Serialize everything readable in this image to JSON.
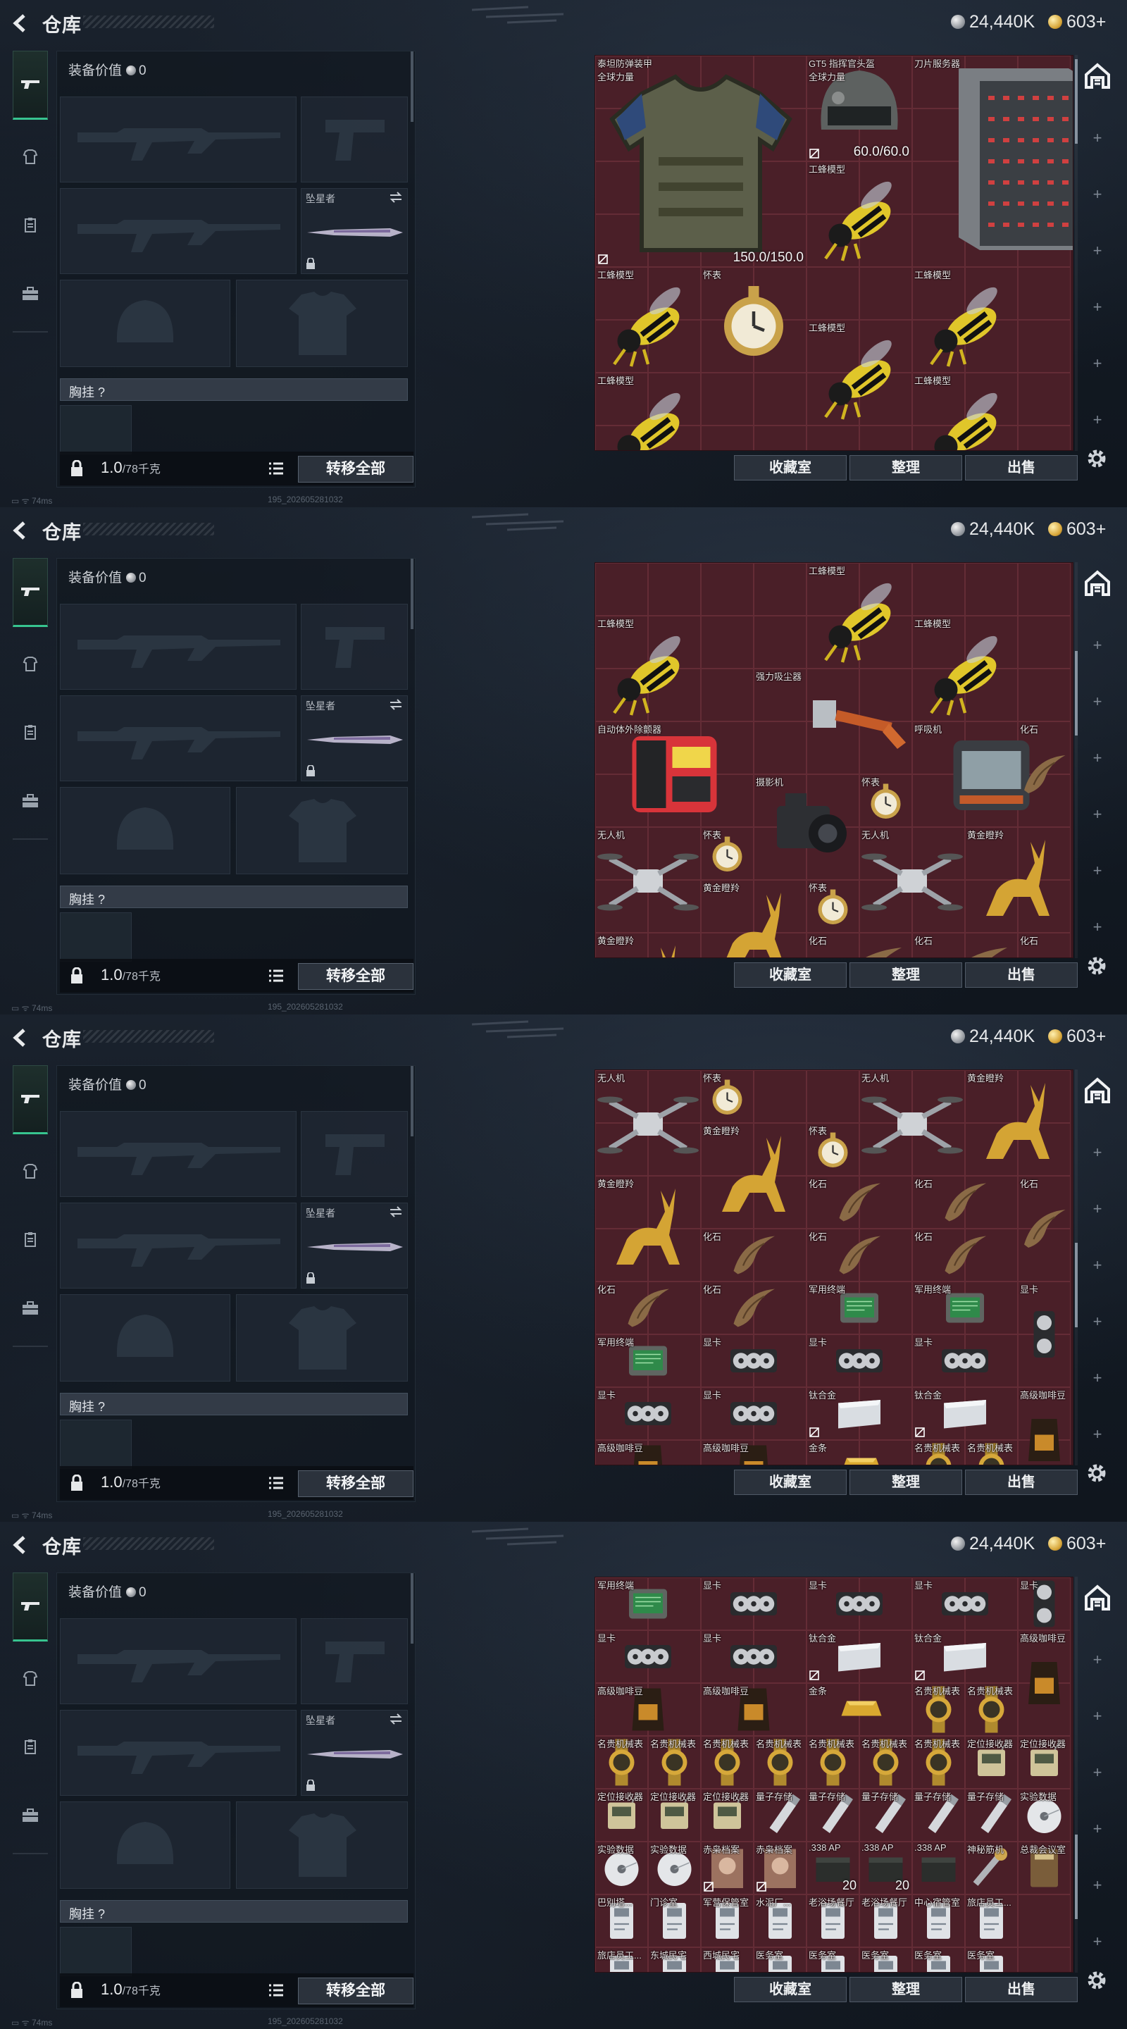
{
  "header": {
    "title": "仓库",
    "currency_1": "24,440K",
    "currency_2": "603+"
  },
  "loadout": {
    "equip_value_label": "装备价值",
    "equip_value": "0",
    "melee_label": "坠星者",
    "chest_label": "胸挂 ?",
    "weight_current": "1.0",
    "weight_max": "/78千克",
    "transfer_all": "转移全部"
  },
  "storage": {
    "buttons": {
      "collection": "收藏室",
      "organize": "整理",
      "sell": "出售"
    }
  },
  "status": {
    "ping": "74ms",
    "build": "195_202605281032"
  },
  "frames": [
    {
      "items": [
        {
          "label": "泰坦防弹装甲\n全球力量",
          "art": "armor",
          "col": 0,
          "row": 0,
          "w": 2,
          "h": 2,
          "durability": "150.0/150.0",
          "nodrop": true
        },
        {
          "label": "GT5 指挥官头盔\n全球力量",
          "art": "helmet",
          "col": 2,
          "row": 0,
          "w": 1,
          "h": 1,
          "durability": "60.0/60.0",
          "nodrop": true
        },
        {
          "label": "刀片服务器",
          "art": "server",
          "col": 3,
          "row": 0,
          "w": 2,
          "h": 2
        },
        {
          "label": "工蜂模型",
          "art": "bee",
          "col": 2,
          "row": 1,
          "w": 1,
          "h": 1
        },
        {
          "label": "工蜂模型",
          "art": "bee",
          "col": 0,
          "row": 2,
          "w": 1,
          "h": 1
        },
        {
          "label": "怀表",
          "art": "watch",
          "col": 1,
          "row": 2,
          "w": 1,
          "h": 1
        },
        {
          "label": "工蜂模型",
          "art": "bee",
          "col": 3,
          "row": 2,
          "w": 1,
          "h": 1
        },
        {
          "label": "工蜂模型",
          "art": "bee",
          "col": 2,
          "row": 2.5,
          "w": 1,
          "h": 1
        },
        {
          "label": "工蜂模型",
          "art": "bee",
          "col": 0,
          "row": 3,
          "w": 1,
          "h": 1
        },
        {
          "label": "工蜂模型",
          "art": "bee",
          "col": 3,
          "row": 3,
          "w": 1,
          "h": 1
        }
      ],
      "scroll": 0
    },
    {
      "items": [
        {
          "label": "工蜂模型",
          "art": "bee",
          "col": 2,
          "row": 0,
          "w": 1,
          "h": 1
        },
        {
          "label": "工蜂模型",
          "art": "bee",
          "col": 0,
          "row": 0.5,
          "w": 1,
          "h": 1
        },
        {
          "label": "工蜂模型",
          "art": "bee",
          "col": 3,
          "row": 0.5,
          "w": 1,
          "h": 1
        },
        {
          "label": "强力吸尘器",
          "art": "vacuum",
          "col": 1.5,
          "row": 1,
          "w": 2,
          "h": 1
        },
        {
          "label": "自动体外除颤器",
          "art": "aed",
          "col": 0,
          "row": 1.5,
          "w": 1.5,
          "h": 1
        },
        {
          "label": "呼吸机",
          "art": "ventilator",
          "col": 3,
          "row": 1.5,
          "w": 1.5,
          "h": 1
        },
        {
          "label": "化石",
          "art": "fossil",
          "col": 4,
          "row": 1.5,
          "w": 0.5,
          "h": 1
        },
        {
          "label": "摄影机",
          "art": "camera",
          "col": 1.5,
          "row": 2,
          "w": 1,
          "h": 1
        },
        {
          "label": "怀表",
          "art": "watch",
          "col": 2.5,
          "row": 2,
          "w": 0.5,
          "h": 0.5
        },
        {
          "label": "无人机",
          "art": "drone",
          "col": 0,
          "row": 2.5,
          "w": 1,
          "h": 1
        },
        {
          "label": "怀表",
          "art": "watch",
          "col": 1,
          "row": 2.5,
          "w": 0.5,
          "h": 0.5
        },
        {
          "label": "无人机",
          "art": "drone",
          "col": 2.5,
          "row": 2.5,
          "w": 1,
          "h": 1
        },
        {
          "label": "黄金瞪羚",
          "art": "gazelle",
          "col": 3.5,
          "row": 2.5,
          "w": 1,
          "h": 1
        },
        {
          "label": "黄金瞪羚",
          "art": "gazelle",
          "col": 1,
          "row": 3,
          "w": 1,
          "h": 1
        },
        {
          "label": "怀表",
          "art": "watch",
          "col": 2,
          "row": 3,
          "w": 0.5,
          "h": 0.5
        },
        {
          "label": "黄金瞪羚",
          "art": "gazelle",
          "col": 0,
          "row": 3.5,
          "w": 1,
          "h": 1
        },
        {
          "label": "化石",
          "art": "fossil",
          "col": 2,
          "row": 3.5,
          "w": 1,
          "h": 1
        },
        {
          "label": "化石",
          "art": "fossil",
          "col": 3,
          "row": 3.5,
          "w": 1,
          "h": 1
        },
        {
          "label": "化石",
          "art": "fossil",
          "col": 4,
          "row": 3.5,
          "w": 1,
          "h": 1
        }
      ],
      "scroll": 1
    },
    {
      "items": [
        {
          "label": "无人机",
          "art": "drone",
          "col": 0,
          "row": 0,
          "w": 1,
          "h": 1
        },
        {
          "label": "怀表",
          "art": "watch",
          "col": 1,
          "row": 0,
          "w": 0.5,
          "h": 0.5
        },
        {
          "label": "无人机",
          "art": "drone",
          "col": 2.5,
          "row": 0,
          "w": 1,
          "h": 1
        },
        {
          "label": "黄金瞪羚",
          "art": "gazelle",
          "col": 3.5,
          "row": 0,
          "w": 1,
          "h": 1
        },
        {
          "label": "黄金瞪羚",
          "art": "gazelle",
          "col": 1,
          "row": 0.5,
          "w": 1,
          "h": 1
        },
        {
          "label": "怀表",
          "art": "watch",
          "col": 2,
          "row": 0.5,
          "w": 0.5,
          "h": 0.5
        },
        {
          "label": "黄金瞪羚",
          "art": "gazelle",
          "col": 0,
          "row": 1,
          "w": 1,
          "h": 1
        },
        {
          "label": "化石",
          "art": "fossil",
          "col": 2,
          "row": 1,
          "w": 1,
          "h": 0.5
        },
        {
          "label": "化石",
          "art": "fossil",
          "col": 3,
          "row": 1,
          "w": 1,
          "h": 0.5
        },
        {
          "label": "化石",
          "art": "fossil",
          "col": 4,
          "row": 1,
          "w": 0.5,
          "h": 1
        },
        {
          "label": "化石",
          "art": "fossil",
          "col": 1,
          "row": 1.5,
          "w": 1,
          "h": 0.5
        },
        {
          "label": "化石",
          "art": "fossil",
          "col": 2,
          "row": 1.5,
          "w": 1,
          "h": 0.5
        },
        {
          "label": "化石",
          "art": "fossil",
          "col": 3,
          "row": 1.5,
          "w": 1,
          "h": 0.5
        },
        {
          "label": "化石",
          "art": "fossil",
          "col": 0,
          "row": 2,
          "w": 1,
          "h": 0.5
        },
        {
          "label": "化石",
          "art": "fossil",
          "col": 1,
          "row": 2,
          "w": 1,
          "h": 0.5
        },
        {
          "label": "军用终端",
          "art": "terminal",
          "col": 2,
          "row": 2,
          "w": 1,
          "h": 0.5
        },
        {
          "label": "军用终端",
          "art": "terminal",
          "col": 3,
          "row": 2,
          "w": 1,
          "h": 0.5
        },
        {
          "label": "显卡",
          "art": "gpu-v",
          "col": 4,
          "row": 2,
          "w": 0.5,
          "h": 1
        },
        {
          "label": "军用终端",
          "art": "terminal",
          "col": 0,
          "row": 2.5,
          "w": 1,
          "h": 0.5
        },
        {
          "label": "显卡",
          "art": "gpu",
          "col": 1,
          "row": 2.5,
          "w": 1,
          "h": 0.5
        },
        {
          "label": "显卡",
          "art": "gpu",
          "col": 2,
          "row": 2.5,
          "w": 1,
          "h": 0.5
        },
        {
          "label": "显卡",
          "art": "gpu",
          "col": 3,
          "row": 2.5,
          "w": 1,
          "h": 0.5
        },
        {
          "label": "显卡",
          "art": "gpu",
          "col": 0,
          "row": 3,
          "w": 1,
          "h": 0.5
        },
        {
          "label": "显卡",
          "art": "gpu",
          "col": 1,
          "row": 3,
          "w": 1,
          "h": 0.5
        },
        {
          "label": "钛合金",
          "art": "titanium",
          "col": 2,
          "row": 3,
          "w": 1,
          "h": 0.5,
          "nodrop": true
        },
        {
          "label": "钛合金",
          "art": "titanium",
          "col": 3,
          "row": 3,
          "w": 1,
          "h": 0.5,
          "nodrop": true
        },
        {
          "label": "高级咖啡豆",
          "art": "coffee",
          "col": 4,
          "row": 3,
          "w": 0.5,
          "h": 1
        },
        {
          "label": "高级咖啡豆",
          "art": "coffee",
          "col": 0,
          "row": 3.5,
          "w": 1,
          "h": 0.5
        },
        {
          "label": "高级咖啡豆",
          "art": "coffee",
          "col": 1,
          "row": 3.5,
          "w": 1,
          "h": 0.5
        },
        {
          "label": "金条",
          "art": "goldbar",
          "col": 2,
          "row": 3.5,
          "w": 1,
          "h": 0.5
        },
        {
          "label": "名贵机械表",
          "art": "mwatch",
          "col": 3,
          "row": 3.5,
          "w": 0.5,
          "h": 0.5
        },
        {
          "label": "名贵机械表",
          "art": "mwatch",
          "col": 3.5,
          "row": 3.5,
          "w": 0.5,
          "h": 0.5
        }
      ],
      "scroll": 2
    },
    {
      "items": [
        {
          "label": "军用终端",
          "art": "terminal",
          "col": 0,
          "row": 0,
          "w": 1,
          "h": 0.5
        },
        {
          "label": "显卡",
          "art": "gpu",
          "col": 1,
          "row": 0,
          "w": 1,
          "h": 0.5
        },
        {
          "label": "显卡",
          "art": "gpu",
          "col": 2,
          "row": 0,
          "w": 1,
          "h": 0.5
        },
        {
          "label": "显卡",
          "art": "gpu",
          "col": 3,
          "row": 0,
          "w": 1,
          "h": 0.5
        },
        {
          "label": "显卡",
          "art": "gpu-v",
          "col": 4,
          "row": 0,
          "w": 0.5,
          "h": 0.5
        },
        {
          "label": "显卡",
          "art": "gpu",
          "col": 0,
          "row": 0.5,
          "w": 1,
          "h": 0.5
        },
        {
          "label": "显卡",
          "art": "gpu",
          "col": 1,
          "row": 0.5,
          "w": 1,
          "h": 0.5
        },
        {
          "label": "钛合金",
          "art": "titanium",
          "col": 2,
          "row": 0.5,
          "w": 1,
          "h": 0.5,
          "nodrop": true
        },
        {
          "label": "钛合金",
          "art": "titanium",
          "col": 3,
          "row": 0.5,
          "w": 1,
          "h": 0.5,
          "nodrop": true
        },
        {
          "label": "高级咖啡豆",
          "art": "coffee",
          "col": 4,
          "row": 0.5,
          "w": 0.5,
          "h": 1
        },
        {
          "label": "高级咖啡豆",
          "art": "coffee",
          "col": 0,
          "row": 1,
          "w": 1,
          "h": 0.5
        },
        {
          "label": "高级咖啡豆",
          "art": "coffee",
          "col": 1,
          "row": 1,
          "w": 1,
          "h": 0.5
        },
        {
          "label": "金条",
          "art": "goldbar",
          "col": 2,
          "row": 1,
          "w": 1,
          "h": 0.5
        },
        {
          "label": "名贵机械表",
          "art": "mwatch",
          "col": 3,
          "row": 1,
          "w": 0.5,
          "h": 0.5
        },
        {
          "label": "名贵机械表",
          "art": "mwatch",
          "col": 3.5,
          "row": 1,
          "w": 0.5,
          "h": 0.5
        },
        {
          "label": "名贵机械表",
          "art": "mwatch",
          "col": 0,
          "row": 1.5,
          "w": 0.5,
          "h": 0.5
        },
        {
          "label": "名贵机械表",
          "art": "mwatch",
          "col": 0.5,
          "row": 1.5,
          "w": 0.5,
          "h": 0.5
        },
        {
          "label": "名贵机械表",
          "art": "mwatch",
          "col": 1,
          "row": 1.5,
          "w": 0.5,
          "h": 0.5
        },
        {
          "label": "名贵机械表",
          "art": "mwatch",
          "col": 1.5,
          "row": 1.5,
          "w": 0.5,
          "h": 0.5
        },
        {
          "label": "名贵机械表",
          "art": "mwatch",
          "col": 2,
          "row": 1.5,
          "w": 0.5,
          "h": 0.5
        },
        {
          "label": "名贵机械表",
          "art": "mwatch",
          "col": 2.5,
          "row": 1.5,
          "w": 0.5,
          "h": 0.5
        },
        {
          "label": "名贵机械表",
          "art": "mwatch",
          "col": 3,
          "row": 1.5,
          "w": 0.5,
          "h": 0.5
        },
        {
          "label": "定位接收器",
          "art": "receiver",
          "col": 3.5,
          "row": 1.5,
          "w": 0.5,
          "h": 0.5
        },
        {
          "label": "定位接收器",
          "art": "receiver",
          "col": 4,
          "row": 1.5,
          "w": 0.5,
          "h": 0.5
        },
        {
          "label": "定位接收器",
          "art": "receiver",
          "col": 0,
          "row": 2,
          "w": 0.5,
          "h": 0.5
        },
        {
          "label": "定位接收器",
          "art": "receiver",
          "col": 0.5,
          "row": 2,
          "w": 0.5,
          "h": 0.5
        },
        {
          "label": "定位接收器",
          "art": "receiver",
          "col": 1,
          "row": 2,
          "w": 0.5,
          "h": 0.5
        },
        {
          "label": "量子存储",
          "art": "usb",
          "col": 1.5,
          "row": 2,
          "w": 0.5,
          "h": 0.5
        },
        {
          "label": "量子存储",
          "art": "usb",
          "col": 2,
          "row": 2,
          "w": 0.5,
          "h": 0.5
        },
        {
          "label": "量子存储",
          "art": "usb",
          "col": 2.5,
          "row": 2,
          "w": 0.5,
          "h": 0.5
        },
        {
          "label": "量子存储",
          "art": "usb",
          "col": 3,
          "row": 2,
          "w": 0.5,
          "h": 0.5
        },
        {
          "label": "量子存储",
          "art": "usb",
          "col": 3.5,
          "row": 2,
          "w": 0.5,
          "h": 0.5
        },
        {
          "label": "实验数据",
          "art": "disc",
          "col": 4,
          "row": 2,
          "w": 0.5,
          "h": 0.5
        },
        {
          "label": "实验数据",
          "art": "disc",
          "col": 0,
          "row": 2.5,
          "w": 0.5,
          "h": 0.5
        },
        {
          "label": "实验数据",
          "art": "disc",
          "col": 0.5,
          "row": 2.5,
          "w": 0.5,
          "h": 0.5
        },
        {
          "label": "赤枭档案",
          "art": "file",
          "col": 1,
          "row": 2.5,
          "w": 0.5,
          "h": 0.5,
          "nodrop": true
        },
        {
          "label": "赤枭档案",
          "art": "file",
          "col": 1.5,
          "row": 2.5,
          "w": 0.5,
          "h": 0.5,
          "nodrop": true
        },
        {
          "label": ".338 AP",
          "art": "ammo",
          "col": 2,
          "row": 2.5,
          "w": 0.5,
          "h": 0.5,
          "count": "20"
        },
        {
          "label": ".338 AP",
          "art": "ammo",
          "col": 2.5,
          "row": 2.5,
          "w": 0.5,
          "h": 0.5,
          "count": "20"
        },
        {
          "label": ".338 AP",
          "art": "ammo",
          "col": 3,
          "row": 2.5,
          "w": 0.5,
          "h": 0.5
        },
        {
          "label": "神秘筋机",
          "art": "pipe",
          "col": 3.5,
          "row": 2.5,
          "w": 0.5,
          "h": 0.5
        },
        {
          "label": "总裁会议室",
          "art": "keycard",
          "col": 4,
          "row": 2.5,
          "w": 0.5,
          "h": 0.5
        },
        {
          "label": "巴别塔...",
          "art": "key",
          "col": 0,
          "row": 3,
          "w": 0.5,
          "h": 0.5
        },
        {
          "label": "门诊室",
          "art": "key",
          "col": 0.5,
          "row": 3,
          "w": 0.5,
          "h": 0.5
        },
        {
          "label": "军营保管室",
          "art": "key",
          "col": 1,
          "row": 3,
          "w": 0.5,
          "h": 0.5
        },
        {
          "label": "水泥厂...",
          "art": "key",
          "col": 1.5,
          "row": 3,
          "w": 0.5,
          "h": 0.5
        },
        {
          "label": "老浴场餐厅",
          "art": "key",
          "col": 2,
          "row": 3,
          "w": 0.5,
          "h": 0.5
        },
        {
          "label": "老浴场餐厅",
          "art": "key",
          "col": 2.5,
          "row": 3,
          "w": 0.5,
          "h": 0.5
        },
        {
          "label": "中心宿管室",
          "art": "key",
          "col": 3,
          "row": 3,
          "w": 0.5,
          "h": 0.5
        },
        {
          "label": "旅店员工...",
          "art": "key",
          "col": 3.5,
          "row": 3,
          "w": 0.5,
          "h": 0.5
        },
        {
          "label": "旅店员工...",
          "art": "key",
          "col": 0,
          "row": 3.5,
          "w": 0.5,
          "h": 0.5
        },
        {
          "label": "东城民宅",
          "art": "key",
          "col": 0.5,
          "row": 3.5,
          "w": 0.5,
          "h": 0.5
        },
        {
          "label": "西城民宅",
          "art": "key",
          "col": 1,
          "row": 3.5,
          "w": 0.5,
          "h": 0.5
        },
        {
          "label": "医务室",
          "art": "key",
          "col": 1.5,
          "row": 3.5,
          "w": 0.5,
          "h": 0.5
        },
        {
          "label": "医务室",
          "art": "key",
          "col": 2,
          "row": 3.5,
          "w": 0.5,
          "h": 0.5
        },
        {
          "label": "医务室",
          "art": "key",
          "col": 2.5,
          "row": 3.5,
          "w": 0.5,
          "h": 0.5
        },
        {
          "label": "医务室",
          "art": "key",
          "col": 3,
          "row": 3.5,
          "w": 0.5,
          "h": 0.5
        },
        {
          "label": "医务室",
          "art": "key",
          "col": 3.5,
          "row": 3.5,
          "w": 0.5,
          "h": 0.5
        }
      ],
      "scroll": 3
    }
  ]
}
